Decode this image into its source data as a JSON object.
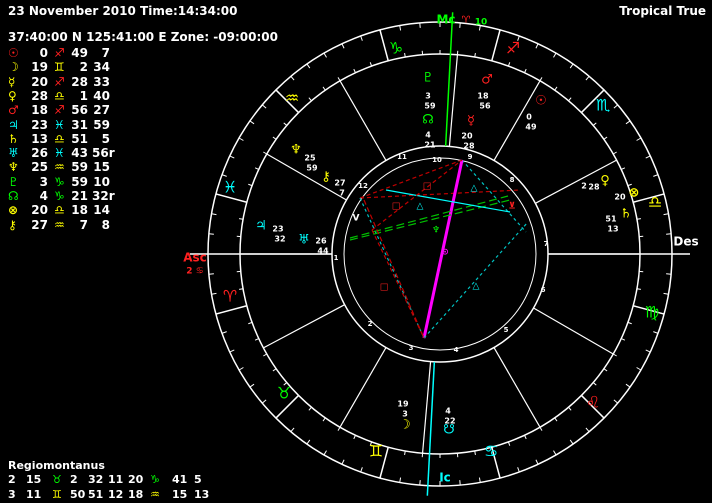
{
  "header": {
    "datetime": "23 November 2010 Time:14:34:00",
    "location": "37:40:00 N 125:41:00 E Zone: -09:00:00",
    "mode": "Tropical True"
  },
  "colors": {
    "bg": "#000000",
    "ring": "#ffffff",
    "fire": "#ff2020",
    "earth": "#00ff00",
    "air": "#ffff00",
    "water": "#00ffff",
    "magenta": "#ff00ff",
    "pink": "#ff6060",
    "line_green": "#00c000",
    "line_cyan": "#00c0c0",
    "line_red": "#c00000"
  },
  "positions": [
    {
      "planet": "Sun",
      "glyph": "☉",
      "pcolor": "#ff2020",
      "deg": "0",
      "sign": "♐",
      "scolor": "#ff2020",
      "min": "49",
      "sec": "7"
    },
    {
      "planet": "Moon",
      "glyph": "☽",
      "pcolor": "#ffff00",
      "deg": "19",
      "sign": "♊",
      "scolor": "#ffff00",
      "min": "2",
      "sec": "34"
    },
    {
      "planet": "Mercury",
      "glyph": "☿",
      "pcolor": "#ffff00",
      "deg": "20",
      "sign": "♐",
      "scolor": "#ff2020",
      "min": "28",
      "sec": "33"
    },
    {
      "planet": "Venus",
      "glyph": "♀",
      "pcolor": "#ffff00",
      "deg": "28",
      "sign": "♎",
      "scolor": "#ffff00",
      "min": "1",
      "sec": "40"
    },
    {
      "planet": "Mars",
      "glyph": "♂",
      "pcolor": "#ff2020",
      "deg": "18",
      "sign": "♐",
      "scolor": "#ff2020",
      "min": "56",
      "sec": "27"
    },
    {
      "planet": "Jupiter",
      "glyph": "♃",
      "pcolor": "#00ffff",
      "deg": "23",
      "sign": "♓",
      "scolor": "#00ffff",
      "min": "31",
      "sec": "59"
    },
    {
      "planet": "Saturn",
      "glyph": "♄",
      "pcolor": "#ffff00",
      "deg": "13",
      "sign": "♎",
      "scolor": "#ffff00",
      "min": "51",
      "sec": "5"
    },
    {
      "planet": "Uranus",
      "glyph": "♅",
      "pcolor": "#00ffff",
      "deg": "26",
      "sign": "♓",
      "scolor": "#00ffff",
      "min": "43",
      "sec": "56r"
    },
    {
      "planet": "Neptune",
      "glyph": "♆",
      "pcolor": "#ffff00",
      "deg": "25",
      "sign": "♒",
      "scolor": "#ffff00",
      "min": "59",
      "sec": "15"
    },
    {
      "planet": "Pluto",
      "glyph": "♇",
      "pcolor": "#00ff00",
      "deg": "3",
      "sign": "♑",
      "scolor": "#00ff00",
      "min": "59",
      "sec": "10"
    },
    {
      "planet": "Node",
      "glyph": "☊",
      "pcolor": "#00ff00",
      "deg": "4",
      "sign": "♑",
      "scolor": "#00ff00",
      "min": "21",
      "sec": "32r"
    },
    {
      "planet": "Fortune",
      "glyph": "⊗",
      "pcolor": "#ffff00",
      "deg": "20",
      "sign": "♎",
      "scolor": "#ffff00",
      "min": "18",
      "sec": "14"
    },
    {
      "planet": "Chiron",
      "glyph": "⚷",
      "pcolor": "#ffff00",
      "deg": "27",
      "sign": "♒",
      "scolor": "#ffff00",
      "min": "7",
      "sec": "8"
    }
  ],
  "house_system": {
    "title": "Regiomontanus",
    "row1": [
      {
        "t": "2",
        "c": "#fff"
      },
      {
        "t": "15",
        "c": "#fff"
      },
      {
        "t": "♉",
        "c": "#00ff00"
      },
      {
        "t": "2",
        "c": "#fff"
      },
      {
        "t": "32",
        "c": "#fff"
      },
      {
        "t": "11",
        "c": "#fff"
      },
      {
        "t": "20",
        "c": "#fff"
      },
      {
        "t": "♑",
        "c": "#00ff00"
      },
      {
        "t": "41",
        "c": "#fff"
      },
      {
        "t": "5",
        "c": "#fff"
      }
    ],
    "row2": [
      {
        "t": "3",
        "c": "#fff"
      },
      {
        "t": "11",
        "c": "#fff"
      },
      {
        "t": "♊",
        "c": "#ffff00"
      },
      {
        "t": "50",
        "c": "#fff"
      },
      {
        "t": "51",
        "c": "#fff"
      },
      {
        "t": "12",
        "c": "#fff"
      },
      {
        "t": "18",
        "c": "#fff"
      },
      {
        "t": "♒",
        "c": "#ffff00"
      },
      {
        "t": "15",
        "c": "#fff"
      },
      {
        "t": "13",
        "c": "#fff"
      }
    ]
  },
  "wheel": {
    "angles": {
      "mc_label": "Mc",
      "mc_sign": "♈",
      "mc_deg": "10",
      "asc_label": "Asc",
      "asc_deg": "2 ♋",
      "des_label": "Des",
      "ic_label": "Ic"
    },
    "signs": [
      {
        "glyph": "♑",
        "color": "#00ff00",
        "name": "capricorn"
      },
      {
        "glyph": "♐",
        "color": "#ff2020",
        "name": "sagittarius"
      },
      {
        "glyph": "♏",
        "color": "#00ffff",
        "name": "scorpio"
      },
      {
        "glyph": "♎",
        "color": "#ffff00",
        "name": "libra"
      },
      {
        "glyph": "♍",
        "color": "#00ff00",
        "name": "virgo"
      },
      {
        "glyph": "♌",
        "color": "#ff2020",
        "name": "leo"
      },
      {
        "glyph": "♋",
        "color": "#00ffff",
        "name": "cancer"
      },
      {
        "glyph": "♊",
        "color": "#ffff00",
        "name": "gemini"
      },
      {
        "glyph": "♉",
        "color": "#00ff00",
        "name": "taurus"
      },
      {
        "glyph": "♈",
        "color": "#ff2020",
        "name": "aries"
      },
      {
        "glyph": "♓",
        "color": "#00ffff",
        "name": "pisces"
      },
      {
        "glyph": "♒",
        "color": "#ffff00",
        "name": "aquarius"
      }
    ],
    "house_numbers": [
      "1",
      "2",
      "3",
      "4",
      "5",
      "6",
      "7",
      "8",
      "9",
      "10",
      "11",
      "12"
    ],
    "planet_labels": [
      {
        "glyph": "♇",
        "color": "#00ff00",
        "deg": "3",
        "min": "59",
        "name": "pluto"
      },
      {
        "glyph": "☊",
        "color": "#00ff00",
        "deg": "4",
        "min": "21",
        "name": "node"
      },
      {
        "glyph": "♂",
        "color": "#ff2020",
        "deg": "18",
        "min": "56",
        "name": "mars"
      },
      {
        "glyph": "☿",
        "color": "#ff2020",
        "deg": "20",
        "min": "28",
        "name": "mercury"
      },
      {
        "glyph": "☉",
        "color": "#ff2020",
        "deg": "0",
        "min": "49",
        "name": "sun"
      },
      {
        "glyph": "♀",
        "color": "#ffff00",
        "deg": "28",
        "min": "",
        "name": "venus-deg"
      },
      {
        "glyph": "⊗",
        "color": "#ffff00",
        "deg": "20",
        "min": "",
        "name": "fortune"
      },
      {
        "glyph": "♄",
        "color": "#ffff00",
        "deg": "51",
        "min": "13",
        "name": "saturn"
      },
      {
        "glyph": "♆",
        "color": "#ffff00",
        "deg": "25",
        "min": "59",
        "name": "neptune"
      },
      {
        "glyph": "⚷",
        "color": "#ffff00",
        "deg": "27",
        "min": "7",
        "name": "chiron"
      },
      {
        "glyph": "♃",
        "color": "#00ffff",
        "deg": "23",
        "min": "32",
        "name": "jupiter"
      },
      {
        "glyph": "♅",
        "color": "#00ffff",
        "deg": "26",
        "min": "44",
        "name": "uranus"
      },
      {
        "glyph": "☽",
        "color": "#ffff00",
        "deg": "19",
        "min": "3",
        "name": "moon"
      },
      {
        "glyph": "☋",
        "color": "#00ffff",
        "deg": "4",
        "min": "22",
        "name": "south-node"
      }
    ],
    "venus_num": "2"
  }
}
